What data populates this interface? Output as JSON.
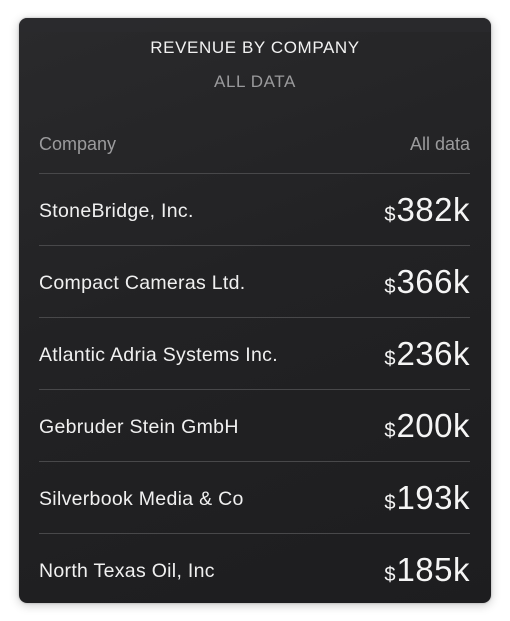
{
  "widget": {
    "title": "REVENUE BY COMPANY",
    "subtitle": "ALL DATA"
  },
  "table": {
    "columns": {
      "company": "Company",
      "value": "All data"
    },
    "rows": [
      {
        "company": "StoneBridge, Inc.",
        "currency": "$",
        "amount": "382k"
      },
      {
        "company": "Compact Cameras Ltd.",
        "currency": "$",
        "amount": "366k"
      },
      {
        "company": "Atlantic Adria Systems Inc.",
        "currency": "$",
        "amount": "236k"
      },
      {
        "company": "Gebruder Stein GmbH",
        "currency": "$",
        "amount": "200k"
      },
      {
        "company": "Silverbook Media & Co",
        "currency": "$",
        "amount": "193k"
      },
      {
        "company": "North Texas Oil, Inc",
        "currency": "$",
        "amount": "185k"
      }
    ]
  },
  "colors": {
    "card_background": "#232325",
    "title_text": "#f2f2f2",
    "secondary_text": "#9a9a9c",
    "divider": "#48484a",
    "value_text": "#f5f5f5"
  }
}
